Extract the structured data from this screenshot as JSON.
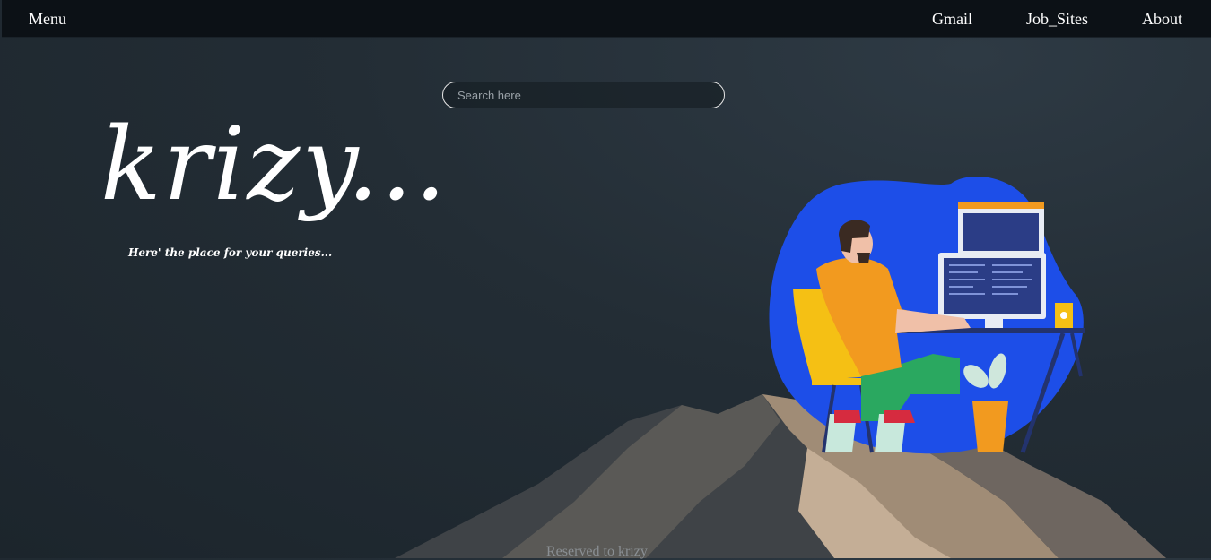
{
  "nav": {
    "menu_label": "Menu",
    "links": [
      "Gmail",
      "Job_Sites",
      "About"
    ]
  },
  "search": {
    "placeholder": "Search here"
  },
  "brand": {
    "logo_text": "krizy...",
    "tagline": "Here' the place for your queries..."
  },
  "footer": {
    "text": "Reserved to krizy"
  },
  "colors": {
    "navbar": "#0c1116",
    "background": "#232d35",
    "blob": "#1d4ee8",
    "shirt": "#f29a1f",
    "chair": "#f5c014",
    "pants": "#2aa860"
  }
}
